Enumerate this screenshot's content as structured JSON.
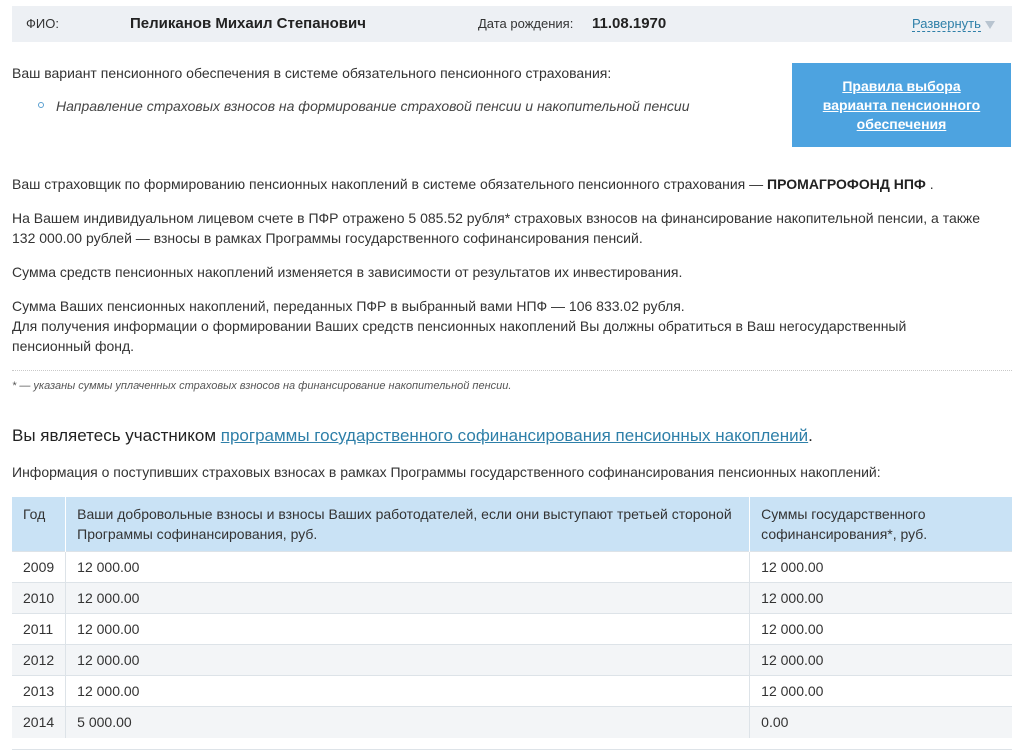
{
  "header": {
    "fio_label": "ФИО:",
    "fio_value": "Пеликанов Михаил Степанович",
    "dob_label": "Дата рождения:",
    "dob_value": "11.08.1970",
    "expand_label": "Развернуть"
  },
  "variant": {
    "intro": "Ваш вариант пенсионного обеспечения в системе обязательного пенсионного страхования:",
    "item": "Направление страховых взносов на формирование страховой пенсии и накопительной пенсии"
  },
  "rules_box": {
    "label": "Правила выбора варианта пенсионного обеспечения"
  },
  "insurer": {
    "text": "Ваш страховщик по формированию пенсионных накоплений в системе обязательного пенсионного страхования —",
    "name": "ПРОМАГРОФОНД НПФ",
    "suffix": "."
  },
  "account_text": "На Вашем индивидуальном лицевом счете в ПФР отражено 5 085.52 рубля* страховых взносов на финансирование накопительной пенсии, а также 132 000.00 рублей — взносы в рамках Программы государственного софинансирования пенсий.",
  "changes_text": "Сумма средств пенсионных накоплений изменяется в зависимости от результатов их инвестирования.",
  "sum_text_1": "Сумма Ваших пенсионных накоплений, переданных ПФР в выбранный вами НПФ — 106 833.02 рубля.",
  "sum_text_2": "Для получения информации о формировании Ваших средств пенсионных накоплений Вы должны обратиться в Ваш негосударственный пенсионный фонд.",
  "footnote": "* — указаны суммы уплаченных страховых взносов на финансирование накопительной пенсии.",
  "member": {
    "prefix": "Вы являетесь участником",
    "link": "программы государственного софинансирования пенсионных накоплений",
    "suffix": "."
  },
  "info_text": "Информация о поступивших страховых взносах в рамках Программы государственного софинансирования пенсионных накоплений:",
  "table": {
    "headers": {
      "year": "Год",
      "voluntary": "Ваши добровольные взносы и взносы Ваших работодателей, если они выступают третьей стороной Программы софинансирования, руб.",
      "state": "Суммы государственного софинансирования*, руб."
    },
    "rows": [
      {
        "year": "2009",
        "voluntary": "12 000.00",
        "state": "12 000.00"
      },
      {
        "year": "2010",
        "voluntary": "12 000.00",
        "state": "12 000.00"
      },
      {
        "year": "2011",
        "voluntary": "12 000.00",
        "state": "12 000.00"
      },
      {
        "year": "2012",
        "voluntary": "12 000.00",
        "state": "12 000.00"
      },
      {
        "year": "2013",
        "voluntary": "12 000.00",
        "state": "12 000.00"
      },
      {
        "year": "2014",
        "voluntary": "5 000.00",
        "state": "0.00"
      }
    ]
  },
  "colors": {
    "header_bg": "#edf0f4",
    "link": "#2e7fa8",
    "rules_box_bg": "#4da3e0",
    "table_header_bg": "#c9e2f5"
  },
  "icons": {
    "expand": "triangle-down-icon",
    "bullet": "circle-bullet-icon"
  }
}
